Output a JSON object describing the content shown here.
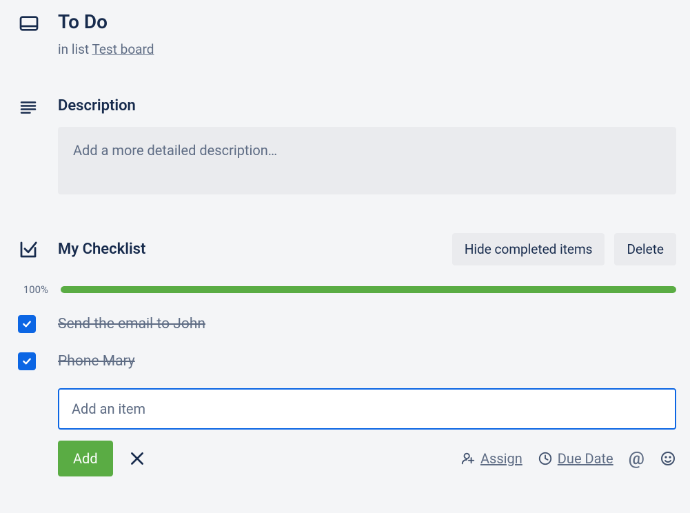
{
  "header": {
    "title": "To Do",
    "list_prefix": "in list ",
    "list_name": "Test board"
  },
  "description": {
    "heading": "Description",
    "placeholder": "Add a more detailed description…"
  },
  "checklist": {
    "title": "My Checklist",
    "hide_label": "Hide completed items",
    "delete_label": "Delete",
    "progress_percent": "100%",
    "progress_value": 100,
    "items": [
      {
        "label": "Send the email to John",
        "checked": true
      },
      {
        "label": "Phone Mary",
        "checked": true
      }
    ],
    "add_placeholder": "Add an item",
    "add_button": "Add",
    "assign_label": "Assign",
    "due_label": "Due Date"
  }
}
